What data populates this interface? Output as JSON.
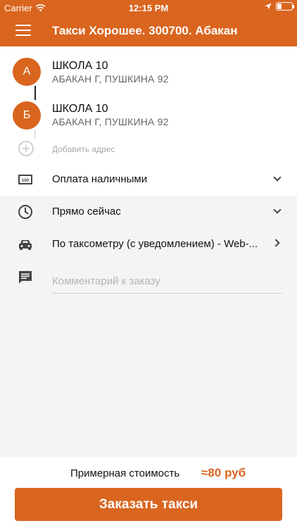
{
  "status_bar": {
    "carrier": "Carrier",
    "time": "12:15 PM",
    "battery_level": 0.3
  },
  "header": {
    "title": "Такси Хорошее. 300700. Абакан"
  },
  "route": {
    "points": [
      {
        "marker": "А",
        "name": "ШКОЛА 10",
        "address": "АБАКАН Г, ПУШКИНА 92"
      },
      {
        "marker": "Б",
        "name": "ШКОЛА 10",
        "address": "АБАКАН Г, ПУШКИНА 92"
      }
    ],
    "add_address_label": "Добавить адрес"
  },
  "payment": {
    "label": "Оплата наличными",
    "icon": "cash-icon"
  },
  "time": {
    "label": "Прямо сейчас",
    "icon": "clock-icon"
  },
  "tariff": {
    "label": "По таксометру (с уведомлением) - Web-...",
    "icon": "car-icon"
  },
  "comment": {
    "placeholder": "Комментарий к заказу",
    "value": "",
    "icon": "comment-icon"
  },
  "footer": {
    "cost_label": "Примерная стоимость",
    "cost_value": "≈80 руб",
    "order_button": "Заказать такси"
  },
  "colors": {
    "accent": "#d9651f",
    "background": "#f4f4f4"
  }
}
